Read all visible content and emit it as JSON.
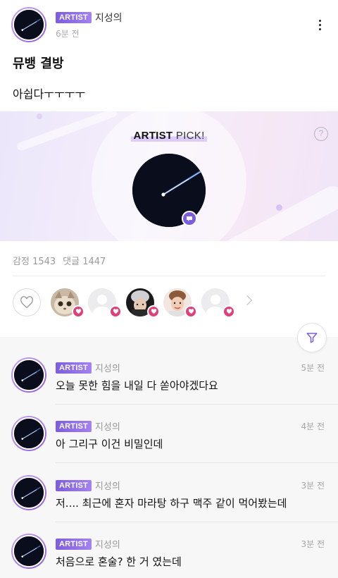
{
  "post": {
    "author_badge": "ARTIST",
    "author_name": "지성의",
    "time": "6분 전",
    "title": "뮤뱅 결방",
    "body": "아쉽다ㅜㅜㅜㅜ"
  },
  "banner": {
    "label_bold": "ARTIST",
    "label_rest": " PICK!",
    "help": "?"
  },
  "stats": {
    "emotion": "감정 1543",
    "comments": "댓글 1447"
  },
  "reactors": [
    {
      "type": "cat"
    },
    {
      "type": "blank"
    },
    {
      "type": "person-dark"
    },
    {
      "type": "person-light"
    },
    {
      "type": "blank"
    }
  ],
  "comments": [
    {
      "badge": "ARTIST",
      "name": "지성의",
      "time": "5분 전",
      "text": "오늘 못한 힘을 내일 다 쏟아야겠다요"
    },
    {
      "badge": "ARTIST",
      "name": "지성의",
      "time": "4분 전",
      "text": "아 그리구 이건 비밀인데"
    },
    {
      "badge": "ARTIST",
      "name": "지성의",
      "time": "3분 전",
      "text": "저.... 최근에 혼자 마라탕 하구 맥주 같이 먹어봤는데"
    },
    {
      "badge": "ARTIST",
      "name": "지성의",
      "time": "3분 전",
      "text": "처음으로 혼술? 한 거 였는데"
    }
  ],
  "colors": {
    "accent": "#7d5ce0",
    "heart": "#e0407a"
  }
}
